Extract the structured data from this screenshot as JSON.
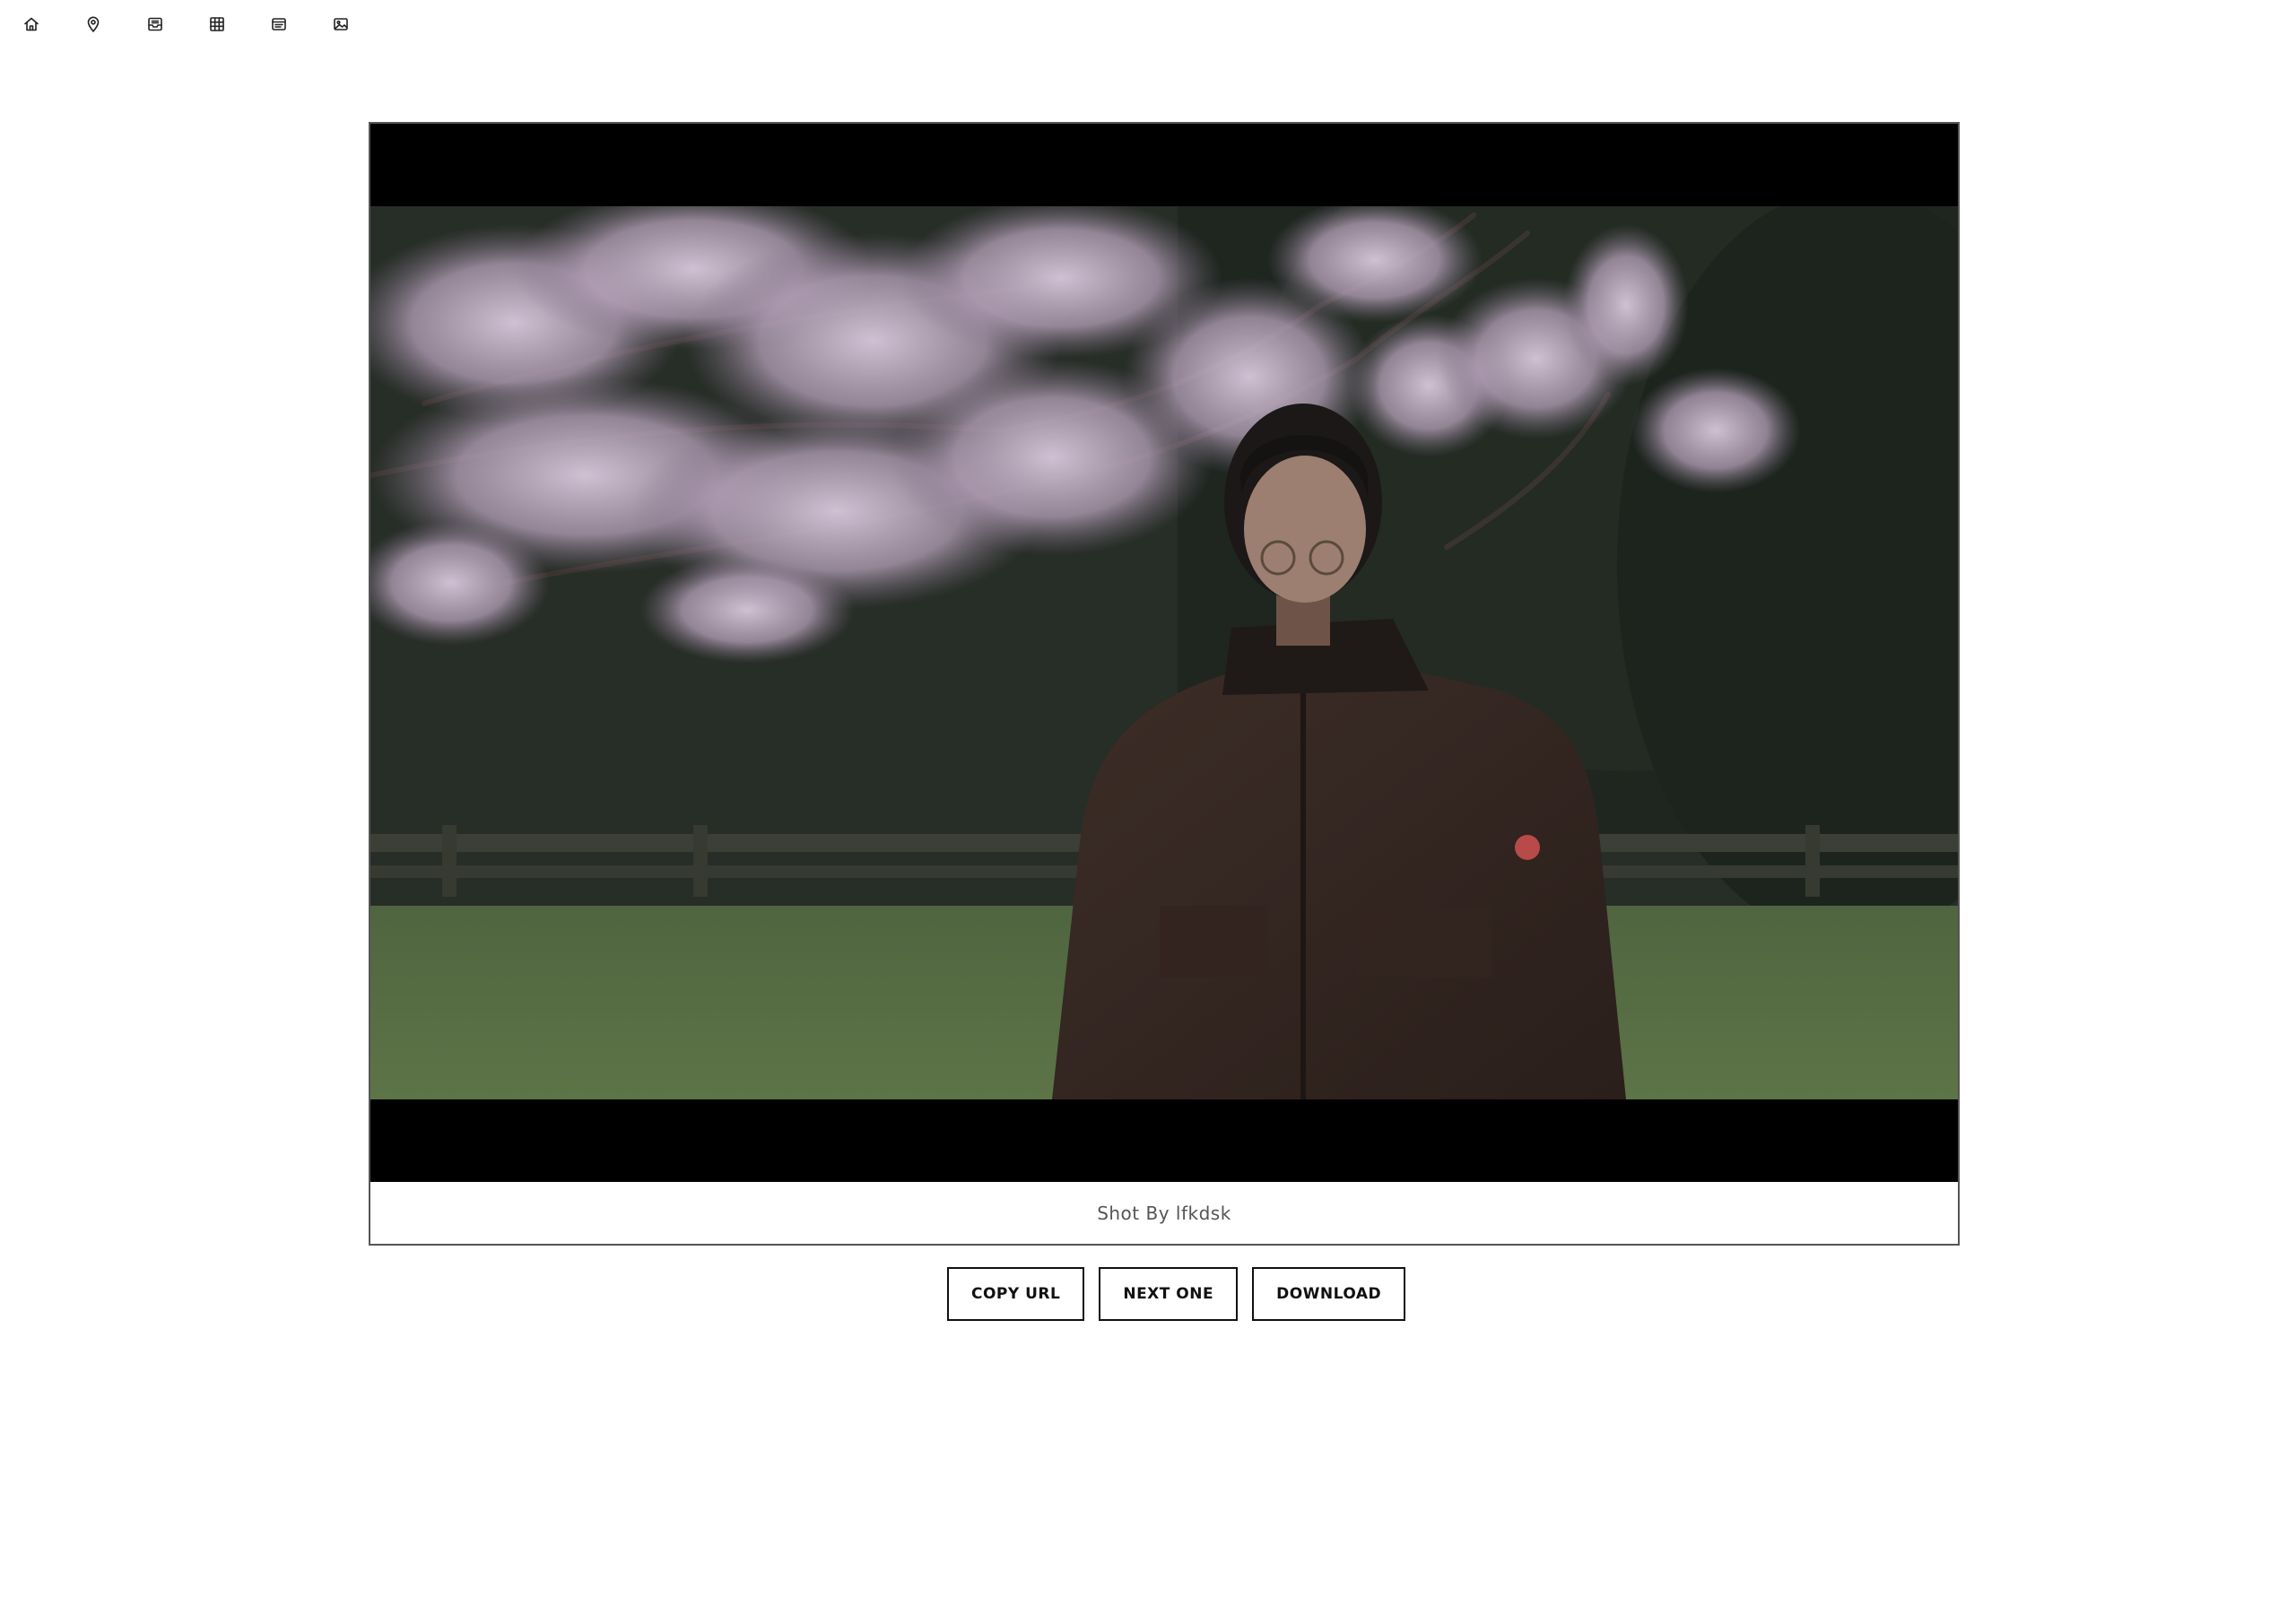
{
  "nav": {
    "icons": [
      "home-icon",
      "map-pin-icon",
      "inbox-icon",
      "grid-icon",
      "list-card-icon",
      "image-icon"
    ]
  },
  "photo": {
    "caption": "Shot By lfkdsk"
  },
  "actions": {
    "copy_url": "COPY URL",
    "next_one": "NEXT ONE",
    "download": "DOWNLOAD"
  }
}
